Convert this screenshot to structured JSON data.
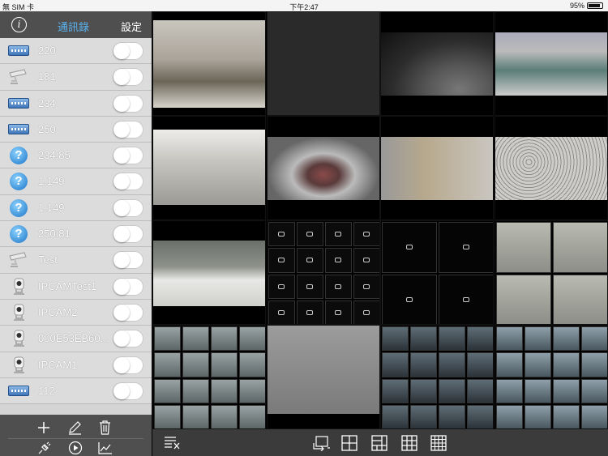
{
  "status": {
    "carrier": "無 SIM 卡",
    "time": "下午2:47",
    "battery": "95%"
  },
  "header": {
    "title": "通訊錄",
    "settings": "設定"
  },
  "devices": [
    {
      "label": "220",
      "icon": "nvr-icon"
    },
    {
      "label": "181",
      "icon": "camera-icon"
    },
    {
      "label": "234",
      "icon": "nvr-icon"
    },
    {
      "label": "250",
      "icon": "nvr-icon"
    },
    {
      "label": "234:85",
      "icon": "unknown-device-icon"
    },
    {
      "label": "1.149",
      "icon": "unknown-device-icon"
    },
    {
      "label": "1.149",
      "icon": "unknown-device-icon"
    },
    {
      "label": "250:81",
      "icon": "unknown-device-icon"
    },
    {
      "label": "Test",
      "icon": "camera-icon"
    },
    {
      "label": "IPCAMTest1",
      "icon": "ip-camera-icon"
    },
    {
      "label": "IPCAM2",
      "icon": "ip-camera-icon"
    },
    {
      "label": "000E53EB60...",
      "icon": "ip-camera-icon"
    },
    {
      "label": "IPCAM1",
      "icon": "ip-camera-icon"
    },
    {
      "label": "112",
      "icon": "nvr-icon"
    }
  ],
  "footer": {
    "add": "plus-icon",
    "edit": "pencil-icon",
    "delete": "trash-icon",
    "connect": "plug-icon",
    "play": "play-icon",
    "chart": "chart-icon"
  },
  "colors": {
    "accent": "#5ab3f2",
    "sidebar": "#d4d4d4",
    "header": "#4f4f4f",
    "toolbar": "#3b3b3b"
  }
}
